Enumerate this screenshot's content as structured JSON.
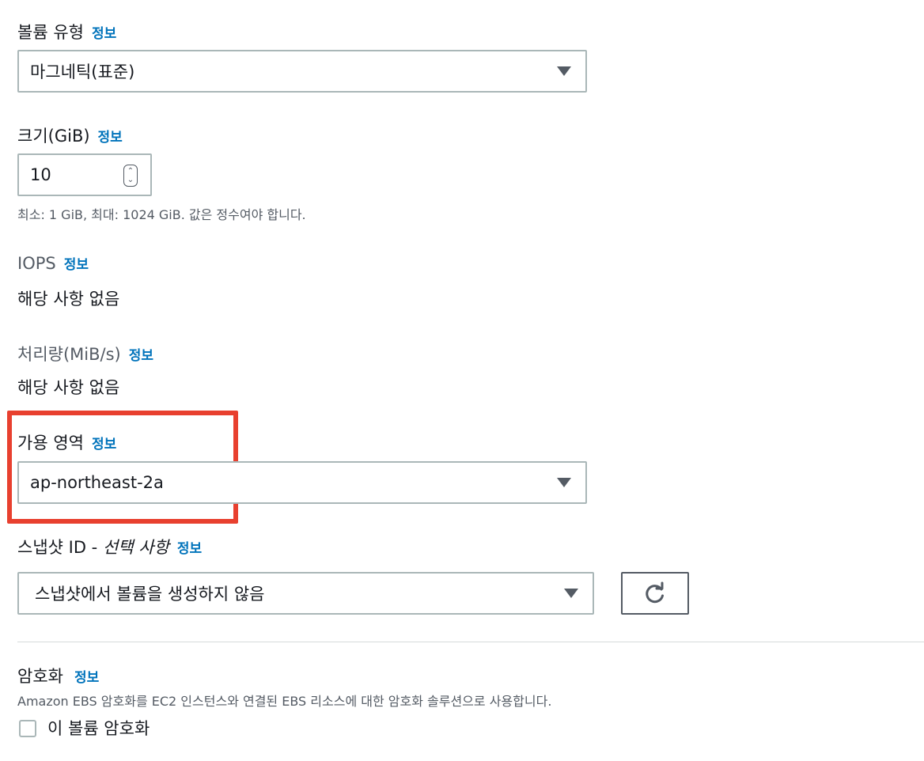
{
  "info_link": "정보",
  "volume_type": {
    "label": "볼륨 유형",
    "value": "마그네틱(표준)"
  },
  "size": {
    "label": "크기(GiB)",
    "value": "10",
    "hint": "최소: 1 GiB, 최대: 1024 GiB. 값은 정수여야 합니다."
  },
  "iops": {
    "label": "IOPS",
    "value": "해당 사항 없음"
  },
  "throughput": {
    "label": "처리량(MiB/s)",
    "value": "해당 사항 없음"
  },
  "availability_zone": {
    "label": "가용 영역",
    "value": "ap-northeast-2a"
  },
  "snapshot": {
    "label": "스냅샷 ID - ",
    "label_optional": "선택 사항",
    "value": "스냅샷에서 볼륨을 생성하지 않음"
  },
  "encryption": {
    "label": "암호화",
    "description": "Amazon EBS 암호화를 EC2 인스턴스와 연결된 EBS 리소스에 대한 암호화 솔루션으로 사용합니다.",
    "checkbox_label": "이 볼륨 암호화"
  },
  "icons": {
    "dropdown": "caret-down-icon",
    "refresh": "refresh-icon",
    "stepper": "stepper-icon",
    "checkbox": "checkbox-icon"
  },
  "colors": {
    "info_link": "#0073bb",
    "highlight": "#e8402f",
    "border": "#aab7b8",
    "text": "#16191f",
    "muted": "#545b64"
  }
}
